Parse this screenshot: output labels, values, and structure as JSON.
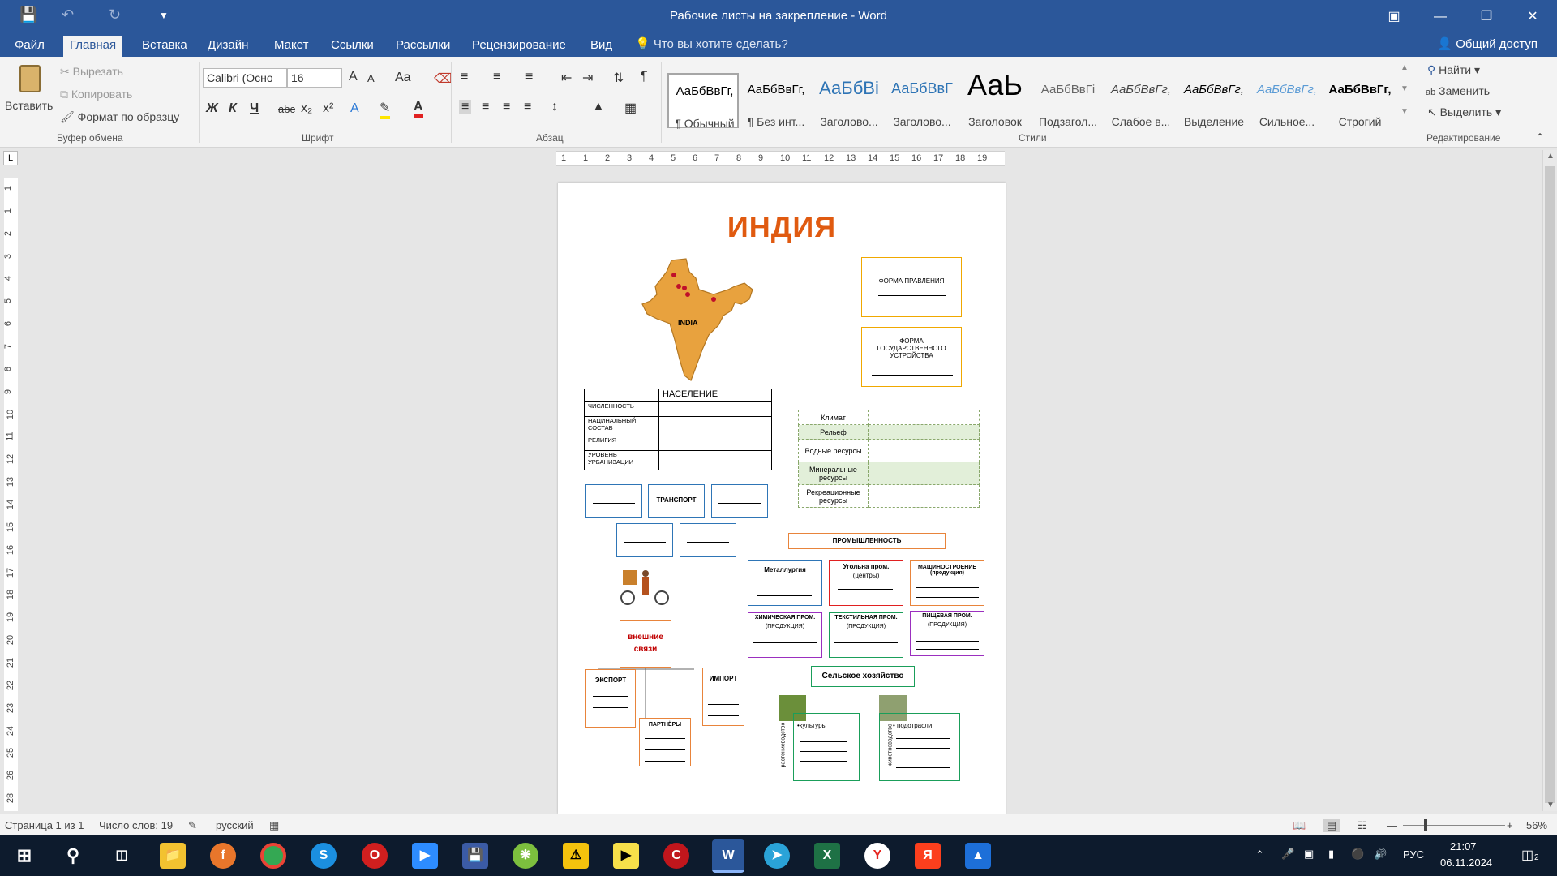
{
  "window": {
    "title": "Рабочие листы на закрепление - Word",
    "minimize_icon": "minimize-icon",
    "restore_icon": "restore-icon",
    "close_icon": "close-icon"
  },
  "tabs": {
    "file": "Файл",
    "items": [
      "Главная",
      "Вставка",
      "Дизайн",
      "Макет",
      "Ссылки",
      "Рассылки",
      "Рецензирование",
      "Вид"
    ],
    "active": "Главная",
    "tell_me": "Что вы хотите сделать?",
    "share": "Общий доступ"
  },
  "clipboard": {
    "paste": "Вставить",
    "cut": "Вырезать",
    "copy": "Копировать",
    "format_painter": "Формат по образцу",
    "label": "Буфер обмена"
  },
  "font": {
    "name": "Calibri (Осно",
    "size": "16",
    "label": "Шрифт",
    "bold": "Ж",
    "italic": "К",
    "underline": "Ч",
    "strike": "abc",
    "sub": "x₂",
    "sup": "x²",
    "grow": "A",
    "shrink": "A",
    "case": "Aa"
  },
  "paragraph": {
    "label": "Абзац"
  },
  "styles": {
    "label": "Стили",
    "items": [
      {
        "preview": "АаБбВвГг,",
        "name": "¶ Обычный"
      },
      {
        "preview": "АаБбВвГг,",
        "name": "¶ Без инт..."
      },
      {
        "preview": "АаБбВі",
        "name": "Заголово..."
      },
      {
        "preview": "АаБбВвГ",
        "name": "Заголово..."
      },
      {
        "preview": "АаЬ",
        "name": "Заголовок"
      },
      {
        "preview": "АаБбВвГі",
        "name": "Подзагол..."
      },
      {
        "preview": "АаБбВвГг,",
        "name": "Слабое в..."
      },
      {
        "preview": "АаБбВвГг,",
        "name": "Выделение"
      },
      {
        "preview": "АаБбВвГг,",
        "name": "Сильное..."
      },
      {
        "preview": "АаБбВвГг,",
        "name": "Строгий"
      }
    ]
  },
  "editing": {
    "label": "Редактирование",
    "find": "Найти",
    "replace": "Заменить",
    "select": "Выделить"
  },
  "ruler": {
    "h_ticks": [
      "1",
      "1",
      "2",
      "3",
      "4",
      "5",
      "6",
      "7",
      "8",
      "9",
      "10",
      "11",
      "12",
      "13",
      "14",
      "15",
      "16",
      "17",
      "18",
      "19"
    ],
    "v_ticks": [
      "1",
      "1",
      "2",
      "3",
      "4",
      "5",
      "6",
      "7",
      "8",
      "9",
      "10",
      "11",
      "12",
      "13",
      "14",
      "15",
      "16",
      "17",
      "18",
      "19",
      "20",
      "21",
      "22",
      "23",
      "24",
      "25",
      "26",
      "28"
    ],
    "corner": "L"
  },
  "document": {
    "heading": "ИНДИЯ",
    "map_label": "INDIA",
    "forma_pravleniya": "ФОРМА ПРАВЛЕНИЯ",
    "forma_ustroystva": "ФОРМА ГОСУДАРСТВЕННОГО УСТРОЙСТВА",
    "population": {
      "header": "НАСЕЛЕНИЕ",
      "rows": [
        "ЧИСЛЕННОСТЬ",
        "НАЦИНАЛЬНЫЙ СОСТАВ",
        "РЕЛИГИЯ",
        "УРОВЕНЬ УРБАНИЗАЦИИ"
      ]
    },
    "nature": {
      "rows": [
        "Климат",
        "Рельеф",
        "Водные ресурсы",
        "Минеральные ресурсы",
        "Рекреационные ресурсы"
      ]
    },
    "transport": "ТРАНСПОРТ",
    "industry": {
      "header": "ПРОМЫШЛЕННОСТЬ",
      "boxes": [
        {
          "title": "Металлургия",
          "sub": ""
        },
        {
          "title": "Угольна пром.",
          "sub": "(центры)"
        },
        {
          "title": "МАШИНОСТРОЕНИЕ (продукция)",
          "sub": ""
        },
        {
          "title": "ХИМИЧЕСКАЯ ПРОМ.",
          "sub": "(ПРОДУКЦИЯ)"
        },
        {
          "title": "ТЕКСТИЛЬНАЯ ПРОМ.",
          "sub": "(ПРОДУКЦИЯ)"
        },
        {
          "title": "ПИЩЕВАЯ ПРОМ.",
          "sub": "(ПРОДУКЦИЯ)"
        }
      ]
    },
    "external": {
      "title_line1": "внешние",
      "title_line2": "связи",
      "export": "ЭКСПОРТ",
      "import": "ИМПОРТ",
      "partners": "ПАРТНЁРЫ"
    },
    "agriculture": {
      "title": "Сельское хозяйство",
      "crop_side": "растениеводство",
      "crop_head": "•культуры",
      "livestock_side": "животноводство",
      "livestock_head": "• подотрасли"
    }
  },
  "status": {
    "page": "Страница 1 из 1",
    "words": "Число слов: 19",
    "language": "русский",
    "zoom": "56%"
  },
  "taskbar": {
    "lang": "РУС",
    "time": "21:07",
    "date": "06.11.2024",
    "notifications": "2"
  }
}
